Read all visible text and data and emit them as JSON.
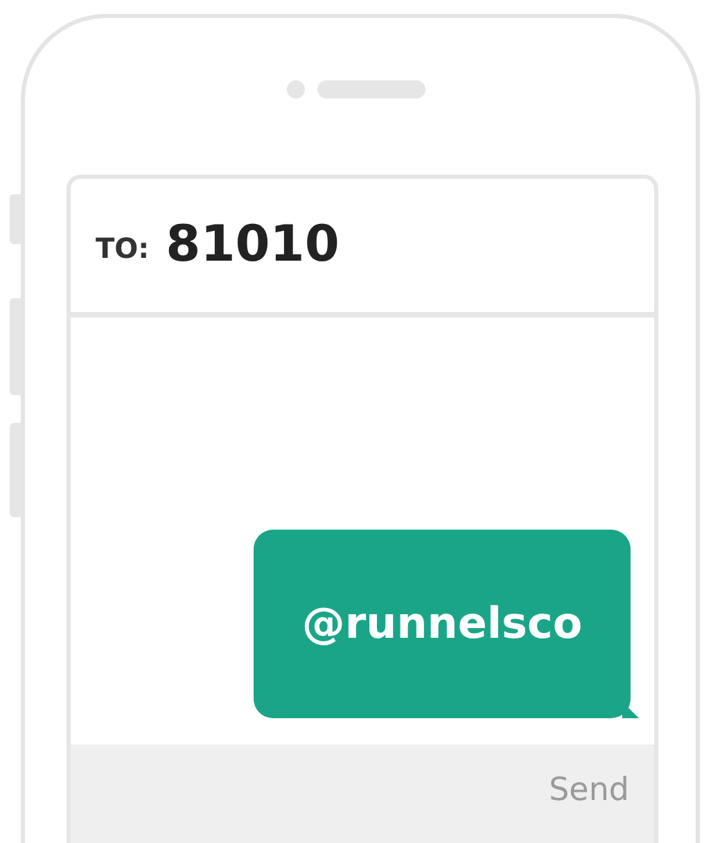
{
  "recipient": {
    "label": "TO:",
    "number": "81010"
  },
  "messages": [
    {
      "text": "@runnelsco",
      "kind": "sent"
    }
  ],
  "composer": {
    "button": "Send"
  }
}
